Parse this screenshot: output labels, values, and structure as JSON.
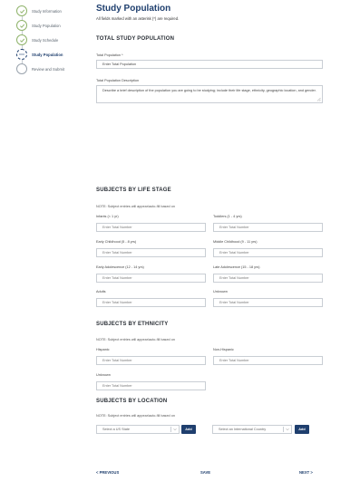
{
  "sidebar": {
    "steps": [
      {
        "label": "Study Information",
        "status": "complete"
      },
      {
        "label": "Study Population",
        "status": "complete"
      },
      {
        "label": "Study Schedule",
        "status": "complete"
      },
      {
        "label": "Study Population",
        "status": "current"
      },
      {
        "label": "Review and Submit",
        "status": "pending"
      }
    ]
  },
  "header": {
    "title": "Study Population",
    "subtitle": "All fields marked with an asterisk (*) are required."
  },
  "total": {
    "heading": "TOTAL STUDY POPULATION",
    "total_label": "Total Population *",
    "total_value": "Enter Total Population",
    "desc_label": "Total Population Description",
    "desc_value": "Describe a brief description of the population you are going to be studying; include their life stage, ethnicity, geographic location, and gender."
  },
  "life_stage": {
    "heading": "SUBJECTS BY LIFE STAGE",
    "hint": "NOTE: Subject entries will appear/auto-fill based on",
    "fields": [
      {
        "label": "Infants (< 1 yr)",
        "placeholder": "Enter Total Number"
      },
      {
        "label": "Toddlers (1 - 4 yrs)",
        "placeholder": "Enter Total Number"
      },
      {
        "label": "Early Childhood (5 - 8 yrs)",
        "placeholder": "Enter Total Number"
      },
      {
        "label": "Middle Childhood (9 - 11 yrs)",
        "placeholder": "Enter Total Number"
      },
      {
        "label": "Early Adolescence (12 - 14 yrs)",
        "placeholder": "Enter Total Number"
      },
      {
        "label": "Late Adolescence (15 - 18 yrs)",
        "placeholder": "Enter Total Number"
      },
      {
        "label": "Adults",
        "placeholder": "Enter Total Number"
      },
      {
        "label": "Unknown",
        "placeholder": "Enter Total Number"
      }
    ]
  },
  "ethnicity": {
    "heading": "SUBJECTS BY ETHNICITY",
    "hint": "NOTE: Subject entries will appear/auto-fill based on",
    "fields": [
      {
        "label": "Hispanic",
        "placeholder": "Enter Total Number"
      },
      {
        "label": "Non-Hispanic",
        "placeholder": "Enter Total Number"
      },
      {
        "label": "Unknown",
        "placeholder": "Enter Total Number"
      }
    ]
  },
  "location": {
    "heading": "SUBJECTS BY LOCATION",
    "hint": "NOTE: Subject entries will appear/auto-fill based on",
    "us_select": "Select a US State",
    "intl_select": "Select an International Country",
    "add_label": "Add"
  },
  "footer": {
    "prev": "< PREVIOUS",
    "save": "SAVE",
    "next": "NEXT >"
  },
  "colors": {
    "primary": "#1f3f6e",
    "complete": "#8fb36a"
  }
}
